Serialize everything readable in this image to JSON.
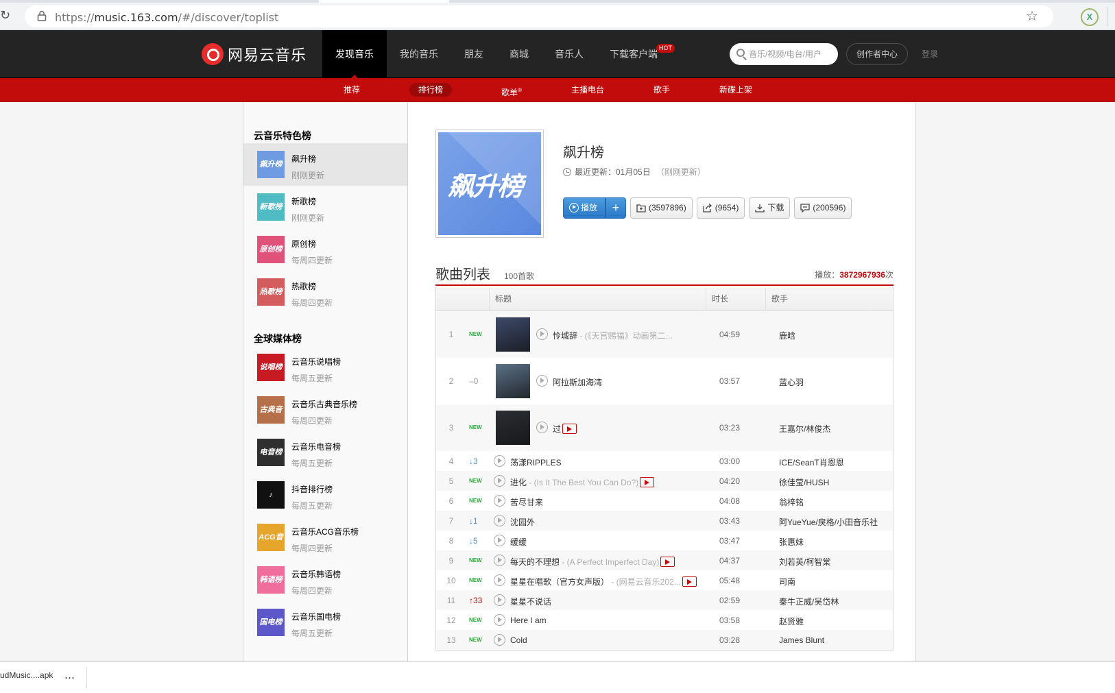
{
  "browser": {
    "url_prefix": "https://",
    "url_host": "music.163.com",
    "url_path": "/#/discover/toplist",
    "ext_label": "X"
  },
  "topnav": {
    "logo": "网易云音乐",
    "items": [
      "发现音乐",
      "我的音乐",
      "朋友",
      "商城",
      "音乐人",
      "下载客户端"
    ],
    "hot_badge": "HOT",
    "search_placeholder": "音乐/视频/电台/用户",
    "creator": "创作者中心",
    "login": "登录"
  },
  "subnav": {
    "items": [
      "推荐",
      "排行榜",
      "歌单",
      "主播电台",
      "歌手",
      "新碟上架"
    ],
    "reg_mark": "®"
  },
  "sidebar": {
    "group1_title": "云音乐特色榜",
    "group1": [
      {
        "name": "飙升榜",
        "update": "刚刚更新",
        "cover_text": "飙升榜",
        "color": "#6f9be3"
      },
      {
        "name": "新歌榜",
        "update": "刚刚更新",
        "cover_text": "新歌榜",
        "color": "#4fbbc2"
      },
      {
        "name": "原创榜",
        "update": "每周四更新",
        "cover_text": "原创榜",
        "color": "#e0527a"
      },
      {
        "name": "热歌榜",
        "update": "每周四更新",
        "cover_text": "热歌榜",
        "color": "#d35d5d"
      }
    ],
    "group2_title": "全球媒体榜",
    "group2": [
      {
        "name": "云音乐说唱榜",
        "update": "每周五更新",
        "cover_text": "说唱榜",
        "color": "#c71a22"
      },
      {
        "name": "云音乐古典音乐榜",
        "update": "每周四更新",
        "cover_text": "古典音乐榜",
        "color": "#b5704a"
      },
      {
        "name": "云音乐电音榜",
        "update": "每周五更新",
        "cover_text": "电音榜",
        "color": "#2f2f2f"
      },
      {
        "name": "抖音排行榜",
        "update": "每周五更新",
        "cover_text": "♪",
        "color": "#111111"
      },
      {
        "name": "云音乐ACG音乐榜",
        "update": "每周四更新",
        "cover_text": "ACG音乐榜",
        "color": "#e6a52b"
      },
      {
        "name": "云音乐韩语榜",
        "update": "每周四更新",
        "cover_text": "韩语榜",
        "color": "#f06e9b"
      },
      {
        "name": "云音乐国电榜",
        "update": "每周五更新",
        "cover_text": "国电榜",
        "color": "#5c58c9"
      }
    ]
  },
  "chart": {
    "cover_text": "飙升榜",
    "title": "飙升榜",
    "updated_label": "最近更新：01月05日",
    "updated_note": "（刚刚更新）",
    "play": "播放",
    "plus": "+",
    "collect": "(3597896)",
    "share": "(9654)",
    "download": "下载",
    "comment": "(200596)"
  },
  "songlist": {
    "heading": "歌曲列表",
    "count": "100首歌",
    "plays_label": "播放：",
    "plays_value": "3872967936",
    "plays_unit": "次",
    "columns": {
      "title": "标题",
      "duration": "时长",
      "artist": "歌手"
    },
    "rows": [
      {
        "rank": "1",
        "trend": "NEW",
        "trend_type": "new",
        "title": "怜城辞",
        "alias": " - (《天官赐福》动画第二...",
        "mv": false,
        "duration": "04:59",
        "artist": "鹿晗",
        "big": true,
        "thumb": "#3d4a6a"
      },
      {
        "rank": "2",
        "trend": "–0",
        "trend_type": "same",
        "title": "阿拉斯加海湾",
        "alias": "",
        "mv": false,
        "duration": "03:57",
        "artist": "蓝心羽",
        "big": true,
        "thumb": "#5b7188"
      },
      {
        "rank": "3",
        "trend": "NEW",
        "trend_type": "new",
        "title": "过",
        "alias": "",
        "mv": true,
        "duration": "03:23",
        "artist": "王嘉尔/林俊杰",
        "big": true,
        "thumb": "#2b2e33"
      },
      {
        "rank": "4",
        "trend": "↓3",
        "trend_type": "down",
        "title": "荡漾RIPPLES",
        "alias": "",
        "mv": false,
        "duration": "03:00",
        "artist": "ICE/SeanT肖恩恩"
      },
      {
        "rank": "5",
        "trend": "NEW",
        "trend_type": "new",
        "title": "进化",
        "alias": " - (Is It The Best You Can Do?)",
        "mv": true,
        "duration": "04:20",
        "artist": "徐佳莹/HUSH"
      },
      {
        "rank": "6",
        "trend": "NEW",
        "trend_type": "new",
        "title": "苦尽甘来",
        "alias": "",
        "mv": false,
        "duration": "04:08",
        "artist": "翁梓铭"
      },
      {
        "rank": "7",
        "trend": "↓1",
        "trend_type": "down",
        "title": "沈园外",
        "alias": "",
        "mv": false,
        "duration": "03:43",
        "artist": "阿YueYue/戾格/小田音乐社"
      },
      {
        "rank": "8",
        "trend": "↓5",
        "trend_type": "down",
        "title": "缓缓",
        "alias": "",
        "mv": false,
        "duration": "03:47",
        "artist": "张惠妹"
      },
      {
        "rank": "9",
        "trend": "NEW",
        "trend_type": "new",
        "title": "每天的不理想",
        "alias": " - (A Perfect Imperfect Day)",
        "mv": true,
        "duration": "04:37",
        "artist": "刘若英/柯智棠"
      },
      {
        "rank": "10",
        "trend": "NEW",
        "trend_type": "new",
        "title": "星星在唱歌（官方女声版）",
        "alias": " - (网易云音乐202...",
        "mv": true,
        "duration": "05:48",
        "artist": "司南"
      },
      {
        "rank": "11",
        "trend": "↑33",
        "trend_type": "up",
        "title": "星星不说话",
        "alias": "",
        "mv": false,
        "duration": "02:59",
        "artist": "秦牛正威/吴岱林"
      },
      {
        "rank": "12",
        "trend": "NEW",
        "trend_type": "new",
        "title": "Here I am",
        "alias": "",
        "mv": false,
        "duration": "03:58",
        "artist": "赵贤雅"
      },
      {
        "rank": "13",
        "trend": "NEW",
        "trend_type": "new",
        "title": "Cold",
        "alias": "",
        "mv": false,
        "duration": "03:28",
        "artist": "James Blunt"
      }
    ]
  },
  "download_bar": {
    "file": "udMusic....apk",
    "more": "..."
  }
}
